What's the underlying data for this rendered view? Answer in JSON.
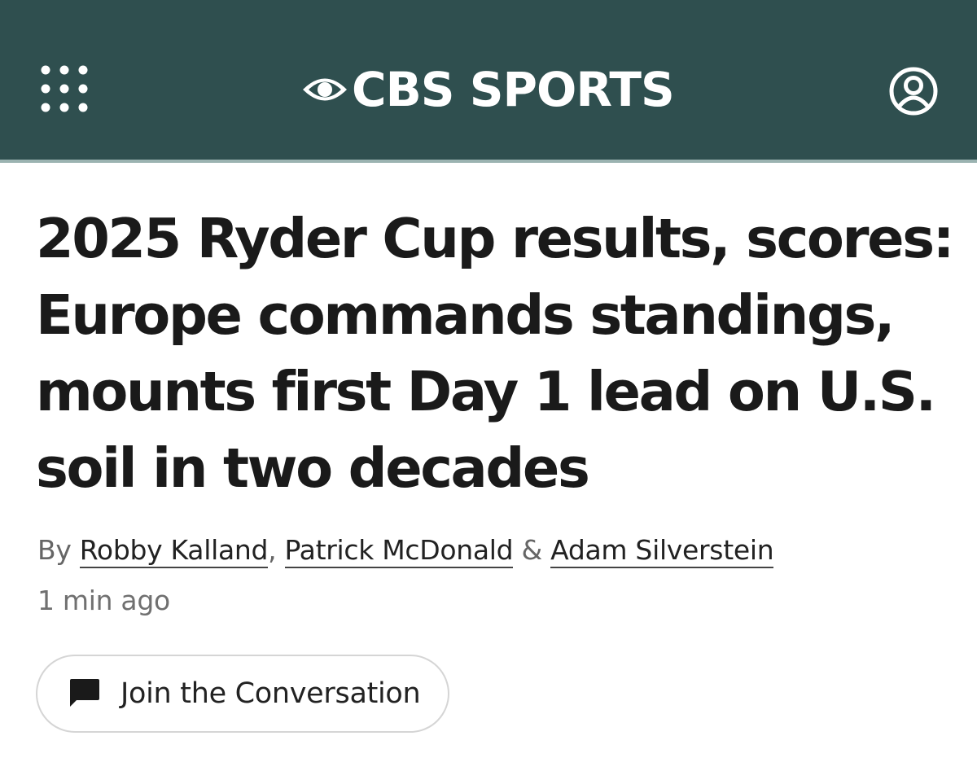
{
  "header": {
    "logo_text": "CBS SPORTS",
    "background_color": "#2f4f4f",
    "menu_icon": "grid-dots-icon",
    "account_icon": "user-circle-icon"
  },
  "article": {
    "headline": "2025 Ryder Cup results, scores: Europe commands standings, mounts first Day 1 lead on U.S. soil in two decades",
    "byline": {
      "prefix": "By",
      "authors": [
        "Robby Kalland",
        "Patrick McDonald",
        "Adam Silverstein"
      ],
      "separator_comma": ",",
      "separator_amp": "&"
    },
    "timestamp": "1 min ago"
  },
  "conversation_button": {
    "label": "Join the Conversation",
    "icon": "chat-bubble-icon"
  }
}
